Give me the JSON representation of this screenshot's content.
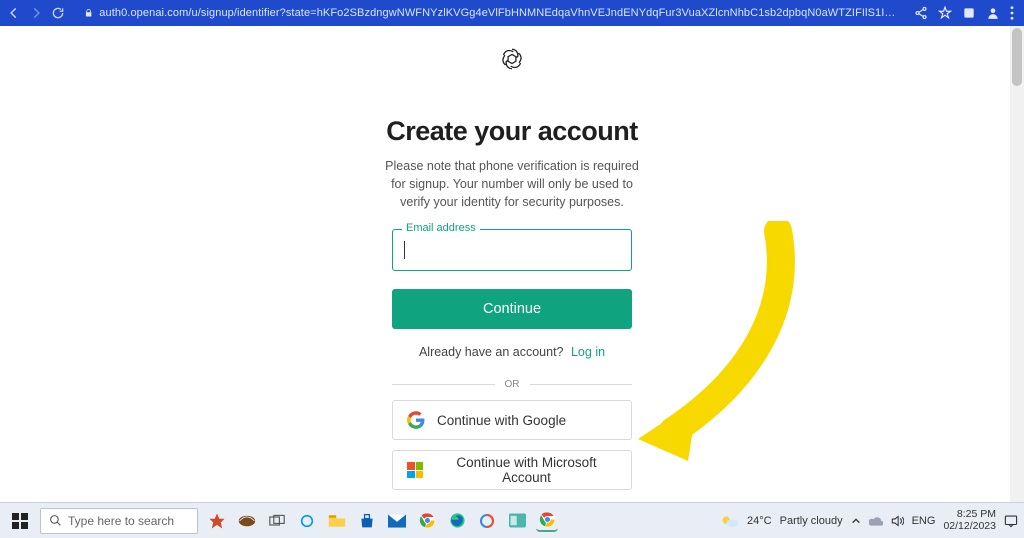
{
  "browser": {
    "url": "auth0.openai.com/u/signup/identifier?state=hKFo2SBzdngwNWFNYzlKVGg4eVlFbHNMNEdqaVhnVEJndENYdqFur3VuaXZlcnNhbC1sb2dpbqN0aWTZIFIlS1IzVll4ZHNHO..."
  },
  "page": {
    "title": "Create your account",
    "subtitle": "Please note that phone verification is required for signup. Your number will only be used to verify your identity for security purposes.",
    "email_label": "Email address",
    "email_value": "",
    "continue_label": "Continue",
    "already_text": "Already have an account?",
    "login_text": "Log in",
    "divider_text": "OR",
    "google_label": "Continue with Google",
    "microsoft_label": "Continue with Microsoft Account"
  },
  "taskbar": {
    "search_placeholder": "Type here to search",
    "weather_temp": "24°C",
    "weather_desc": "Partly cloudy",
    "lang": "ENG",
    "time": "8:25 PM",
    "date": "02/12/2023"
  }
}
